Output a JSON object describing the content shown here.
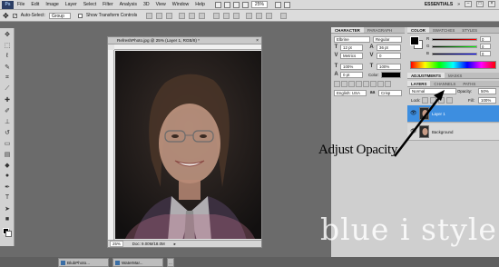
{
  "app": {
    "logo": "Ps",
    "menu": [
      "File",
      "Edit",
      "Image",
      "Layer",
      "Select",
      "Filter",
      "Analysis",
      "3D",
      "View",
      "Window",
      "Help"
    ],
    "zoom": "25%",
    "workspace": "ESSENTIALS"
  },
  "options_bar": {
    "auto_select_label": "Auto-Select:",
    "auto_select_target": "Group",
    "transform_label": "Show Transform Controls"
  },
  "document": {
    "title": "RefreshPhoto.jpg @ 25% (Layer 1, RGB/8) *",
    "status_zoom": "25%",
    "status_doc": "Doc: 9.00M/18.0M"
  },
  "character_panel": {
    "tabs": [
      "CHARACTER",
      "PARAGRAPH"
    ],
    "font_family": "Elbrine",
    "font_style": "Regular",
    "font_size": "12 pt",
    "leading": "36 pt",
    "kerning": "Metrics",
    "tracking": "0",
    "vertical_scale": "100%",
    "horizontal_scale": "100%",
    "baseline": "0 pt",
    "color_label": "Color:",
    "language": "English: USA",
    "antialias": "Crisp"
  },
  "color_panel": {
    "tabs": [
      "COLOR",
      "SWATCHES",
      "STYLES"
    ],
    "r": "0",
    "g": "0",
    "b": "0"
  },
  "adjustments_bar": {
    "tabs": [
      "ADJUSTMENTS",
      "MASKS"
    ]
  },
  "layers_panel": {
    "tabs": [
      "LAYERS",
      "CHANNELS",
      "PATHS"
    ],
    "blend_mode": "Normal",
    "opacity_label": "Opacity:",
    "opacity": "50%",
    "lock_label": "Lock:",
    "fill_label": "Fill:",
    "fill": "100%",
    "layers": [
      "Layer 1",
      "Background"
    ]
  },
  "taskbar": {
    "items": [
      "BlubPhoto...",
      "WaterMar...",
      "..."
    ]
  },
  "annotation": {
    "text": "Adjust Opacity"
  },
  "watermark": {
    "text": "blue i style"
  },
  "colors": {
    "accent_selection": "#3d8ee0",
    "workspace_bg": "#6b6b6b"
  }
}
